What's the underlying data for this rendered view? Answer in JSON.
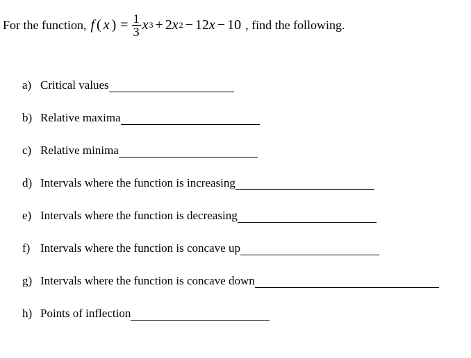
{
  "prompt_prefix": "For the function,",
  "prompt_suffix": ", find the following.",
  "formula": {
    "lhs_fn": "f",
    "lhs_var": "x",
    "frac_num": "1",
    "frac_den": "3",
    "t1_var": "x",
    "t1_exp": "3",
    "t2_coef": "2",
    "t2_var": "x",
    "t2_exp": "2",
    "t3_coef": "12",
    "t3_var": "x",
    "t4_const": "10"
  },
  "items": [
    {
      "letter": "a)",
      "label": "Critical values",
      "blank": "w-short"
    },
    {
      "letter": "b)",
      "label": "Relative maxima",
      "blank": "w-med"
    },
    {
      "letter": "c)",
      "label": "Relative minima",
      "blank": "w-med"
    },
    {
      "letter": "d)",
      "label": "Intervals where the function is increasing",
      "blank": "w-med"
    },
    {
      "letter": "e)",
      "label": "Intervals where the function is decreasing",
      "blank": "w-med"
    },
    {
      "letter": "f)",
      "label": "Intervals where the function is concave up",
      "blank": "w-med"
    },
    {
      "letter": "g)",
      "label": "Intervals where the function is concave down",
      "blank": "w-long"
    },
    {
      "letter": "h)",
      "label": "Points of inflection",
      "blank": "w-med"
    }
  ]
}
